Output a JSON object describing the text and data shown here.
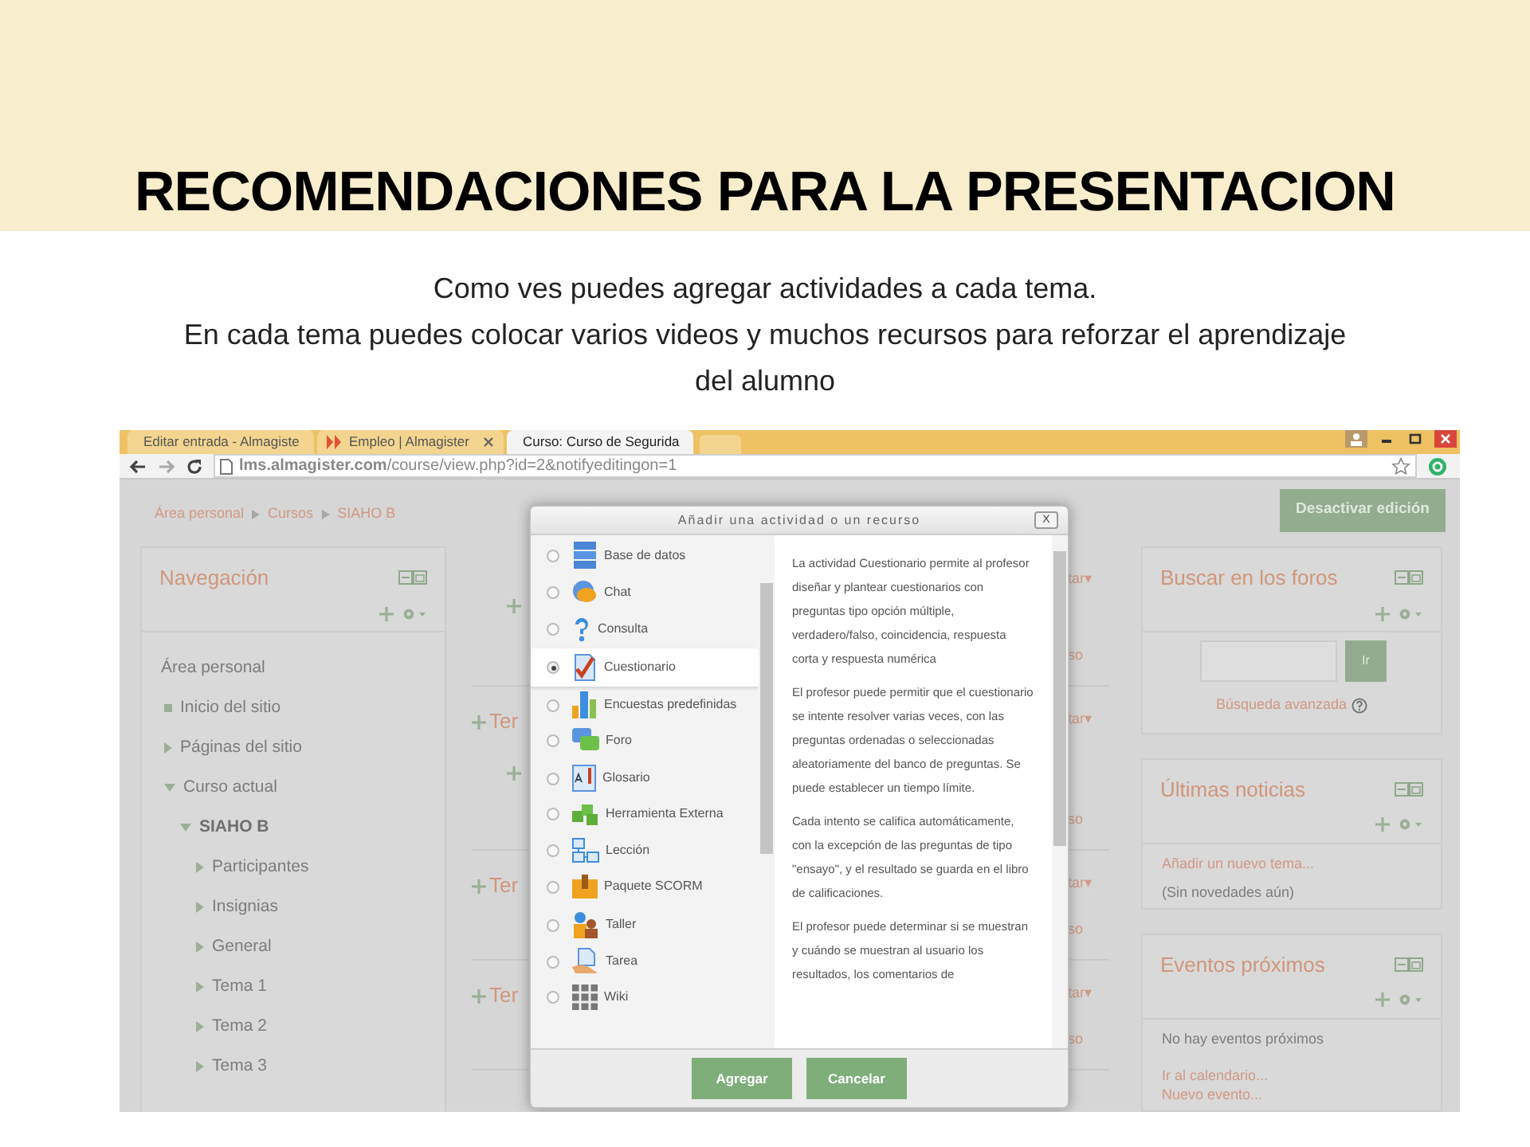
{
  "slide": {
    "title": "RECOMENDACIONES PARA LA PRESENTACION",
    "paragraphs": [
      "Como ves puedes agregar actividades a cada tema.",
      "En cada tema puedes colocar varios videos y muchos recursos para reforzar el aprendizaje del alumno"
    ]
  },
  "browser": {
    "tabs": [
      {
        "label": "Editar entrada - Almagiste",
        "selected": false
      },
      {
        "label": "Empleo | Almagister",
        "selected": false
      },
      {
        "label": "Curso: Curso de Segurida",
        "selected": true
      }
    ],
    "url": "**lms.almagister.com**/course/view.php?id=2&notifyeditingon=1"
  },
  "page": {
    "breadcrumb": [
      "Área personal",
      "Cursos",
      "SIAHO B"
    ],
    "edit_button": "Desactivar edición",
    "navigation": {
      "title": "Navegación",
      "items": [
        {
          "label": "Área personal",
          "kind": "plain",
          "children": [
            {
              "label": "Inicio del sitio",
              "kind": "leaf"
            },
            {
              "label": "Páginas del sitio",
              "kind": "branch",
              "expanded": false
            },
            {
              "label": "Curso actual",
              "kind": "branch",
              "expanded": true,
              "children": [
                {
                  "label": "SIAHO B",
                  "kind": "course",
                  "expanded": true,
                  "children": [
                    {
                      "label": "Participantes",
                      "kind": "branch",
                      "expanded": false
                    },
                    {
                      "label": "Insignias",
                      "kind": "branch",
                      "expanded": false
                    },
                    {
                      "label": "General",
                      "kind": "branch",
                      "expanded": false
                    },
                    {
                      "label": "Tema 1",
                      "kind": "branch",
                      "expanded": false
                    },
                    {
                      "label": "Tema 2",
                      "kind": "branch",
                      "expanded": false
                    },
                    {
                      "label": "Tema 3",
                      "kind": "branch",
                      "expanded": false
                    }
                  ]
                }
              ]
            }
          ]
        }
      ]
    },
    "sections": [
      {
        "edit": "tar▾",
        "link": "so",
        "activity_handle": true
      },
      {
        "heading": "Ter",
        "edit": "tar▾",
        "link": "so",
        "activity_handle": true
      },
      {
        "heading": "Ter",
        "edit": "tar▾",
        "link": "so",
        "activity_handle": false
      },
      {
        "heading": "Ter",
        "edit": "tar▾",
        "link": "so",
        "activity_handle": false
      }
    ],
    "blocks": [
      {
        "kind": "search",
        "title": "Buscar en los foros",
        "button": "Ir",
        "link": "Búsqueda avanzada"
      },
      {
        "kind": "list",
        "title": "Últimas noticias",
        "lines": [
          {
            "kind": "link",
            "text": "Añadir un nuevo tema..."
          },
          {
            "kind": "text",
            "text": "(Sin novedades aún)"
          }
        ]
      },
      {
        "kind": "list",
        "title": "Eventos próximos",
        "lines": [
          {
            "kind": "text",
            "text": "No hay eventos próximos"
          },
          {
            "kind": "link",
            "text": "Ir al calendario..."
          },
          {
            "kind": "link",
            "text": "Nuevo evento..."
          }
        ]
      }
    ]
  },
  "dialog": {
    "title": "Añadir una actividad o un recurso",
    "close": "X",
    "options": [
      {
        "label": "Base de datos",
        "selected": false
      },
      {
        "label": "Chat",
        "selected": false
      },
      {
        "label": "Consulta",
        "selected": false
      },
      {
        "label": "Cuestionario",
        "selected": true
      },
      {
        "label": "Encuestas predefinidas",
        "selected": false
      },
      {
        "label": "Foro",
        "selected": false
      },
      {
        "label": "Glosario",
        "selected": false
      },
      {
        "label": "Herramienta Externa",
        "selected": false
      },
      {
        "label": "Lección",
        "selected": false
      },
      {
        "label": "Paquete SCORM",
        "selected": false
      },
      {
        "label": "Taller",
        "selected": false
      },
      {
        "label": "Tarea",
        "selected": false
      },
      {
        "label": "Wiki",
        "selected": false
      }
    ],
    "description": [
      "La actividad Cuestionario permite al profesor diseñar y plantear cuestionarios con preguntas tipo opción múltiple, verdadero/falso, coincidencia, respuesta corta y respuesta numérica",
      "El profesor puede permitir que el cuestionario se intente resolver varias veces, con las preguntas ordenadas o seleccionadas aleatoriamente del banco de preguntas. Se puede establecer un tiempo límite.",
      "Cada intento se califica automáticamente, con la excepción de las preguntas de tipo \"ensayo\", y el resultado se guarda en el libro de calificaciones.",
      "El profesor puede determinar si se muestran y cuándo se muestran al usuario los resultados, los comentarios de"
    ],
    "buttons": [
      "Agregar",
      "Cancelar"
    ]
  }
}
